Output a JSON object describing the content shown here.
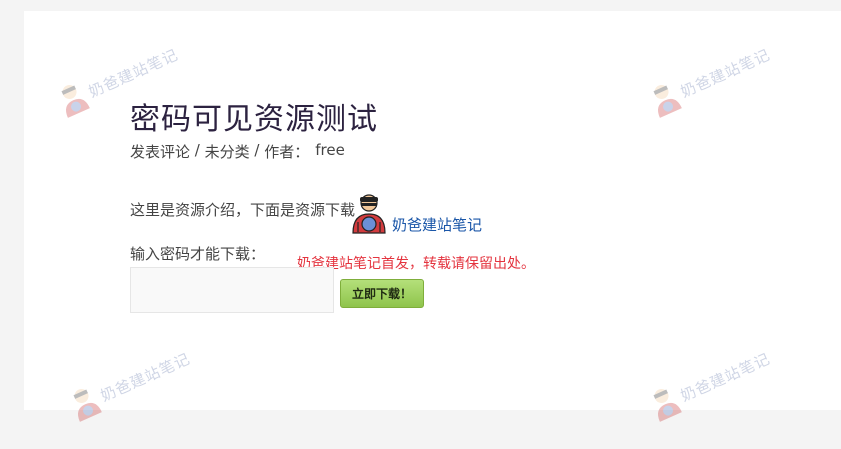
{
  "post": {
    "title": "密码可见资源测试",
    "meta": {
      "comment": "发表评论",
      "sep1": " / ",
      "category": "未分类",
      "sep2": " / ",
      "author_label": "作者：",
      "author": "free"
    },
    "intro": "这里是资源介绍，下面是资源下载",
    "password_label": "输入密码才能下载：",
    "password_value": "",
    "download_button": "立即下载！",
    "copyright_note": "奶爸建站笔记首发，转载请保留出处。"
  },
  "brand": {
    "name": "奶爸建站笔记",
    "mascot_icon": "mascot-icon",
    "link_color": "#1a56a8"
  },
  "watermarks": [
    {
      "text": "奶爸建站笔记"
    },
    {
      "text": "奶爸建站笔记"
    },
    {
      "text": "奶爸建站笔记"
    },
    {
      "text": "奶爸建站笔记"
    }
  ],
  "colors": {
    "title": "#2c2240",
    "note": "#e4343f",
    "button": "#9acd58"
  }
}
